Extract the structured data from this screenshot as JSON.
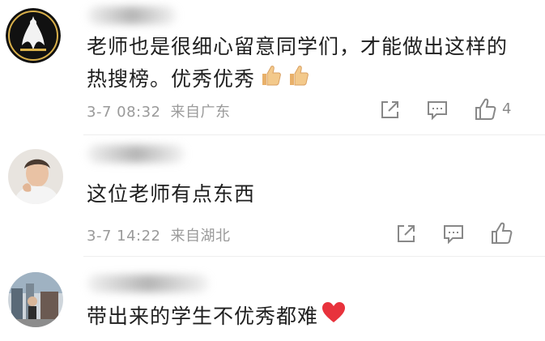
{
  "comments": [
    {
      "username": "",
      "text": "老师也是很细心留意同学们，才能做出这样的热搜榜。优秀优秀",
      "text_line1": "老师也是很细心留意同学们，才能做出这样的",
      "text_line2": "热搜榜。优秀优秀",
      "emoji": [
        "thumbs-up-icon",
        "thumbs-up-icon"
      ],
      "time": "3-7 08:32",
      "location": "来自广东",
      "likes": "4"
    },
    {
      "username": "",
      "text": "这位老师有点东西",
      "time": "3-7 14:22",
      "location": "来自湖北",
      "likes": ""
    },
    {
      "username": "",
      "text": "带出来的学生不优秀都难",
      "emoji": [
        "red-heart-icon"
      ]
    }
  ],
  "colors": {
    "text": "#1f1f1f",
    "meta": "#9a9a9a",
    "icon": "#888888",
    "heart": "#e8323c",
    "thumb": "#f3c98b"
  }
}
